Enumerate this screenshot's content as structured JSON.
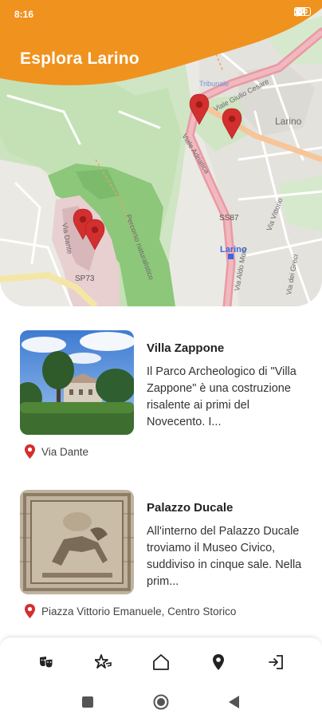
{
  "status_bar": {
    "time": "8:16",
    "battery": "100"
  },
  "header": {
    "title": "Esplora Larino",
    "color": "#F0921E"
  },
  "map": {
    "labels": {
      "town": "Larino",
      "road_ss87": "SS87",
      "road_sp73": "SP73",
      "city_blue": "Larino",
      "via_giulio_cesare": "Viale Giulio Cesare",
      "via_adriatica": "Viale Adriatica",
      "via_dante": "Via Dante",
      "percorso": "Percorso naturalistico",
      "via_viola": "Via Vittorio",
      "tribunale": "Tribunale",
      "via_aldo_moro": "Via Aldo Moro",
      "via_dei_greci": "Via dei Greci"
    }
  },
  "places": [
    {
      "name": "Villa Zappone",
      "description": "Il Parco Archeologico di \"Villa Zappone\" è una costruzione risalente ai primi del Novecento. I...",
      "address": "Via Dante",
      "image": "villa-photo"
    },
    {
      "name": "Palazzo Ducale",
      "description": "All'interno del Palazzo Ducale troviamo il Museo Civico, suddiviso in cinque sale. Nella prim...",
      "address": "Piazza Vittorio Emanuele, Centro Storico",
      "image": "mosaic-photo"
    }
  ],
  "bottom_nav": [
    {
      "icon": "theater-masks-icon"
    },
    {
      "icon": "star-hand-icon"
    },
    {
      "icon": "home-icon"
    },
    {
      "icon": "map-pin-icon"
    },
    {
      "icon": "login-icon"
    }
  ],
  "colors": {
    "accent": "#F0921E",
    "pin": "#D32F2F",
    "park": "#8CC77A"
  }
}
